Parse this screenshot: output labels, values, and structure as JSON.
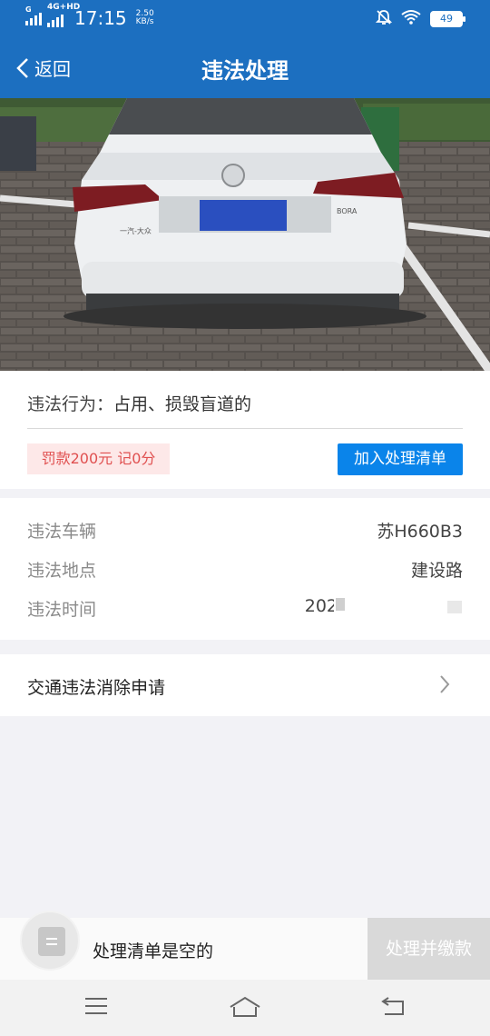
{
  "status_bar": {
    "network": "4G+HD",
    "sim_label": "G",
    "time": "17:15",
    "speed_value": "2.50",
    "speed_unit": "KB/s",
    "battery": "49"
  },
  "nav": {
    "back_label": "返回",
    "title": "违法处理"
  },
  "photo": {
    "plate_text": "一汽-大众",
    "model_text": "BORA"
  },
  "violation": {
    "behavior_label": "违法行为：",
    "behavior_value": "占用、损毁盲道的",
    "fine_text": "罚款200元 记0分",
    "add_button": "加入处理清单"
  },
  "details": {
    "rows": [
      {
        "label": "违法车辆",
        "value": "苏H660B3"
      },
      {
        "label": "违法地点",
        "value": "建设路"
      },
      {
        "label": "违法时间",
        "value": "202"
      }
    ]
  },
  "appeal": {
    "label": "交通违法消除申请"
  },
  "cart": {
    "empty_text": "处理清单是空的",
    "pay_button": "处理并缴款"
  },
  "colors": {
    "primary": "#1c6fc0",
    "button_blue": "#0a84ea",
    "fine_red": "#e05050",
    "fine_bg": "#fde8e8"
  }
}
